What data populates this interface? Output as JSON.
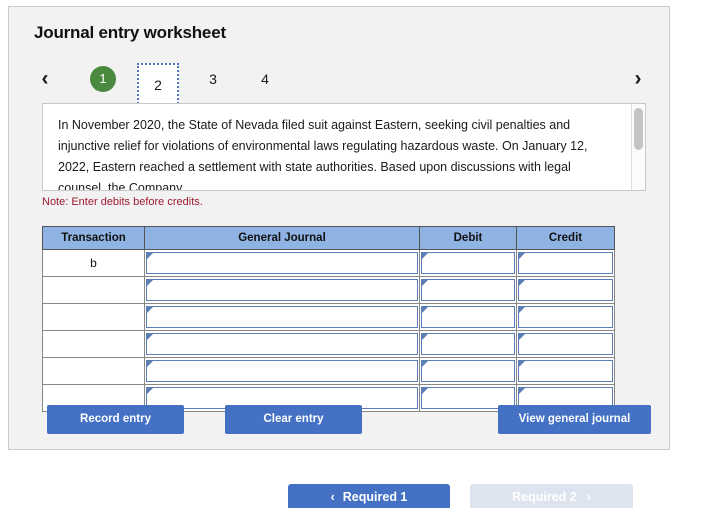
{
  "card": {
    "title": "Journal entry worksheet"
  },
  "tabs": {
    "prev_icon": "chevron-left-icon",
    "next_icon": "chevron-right-icon",
    "items": [
      {
        "label": "1",
        "state": "completed"
      },
      {
        "label": "2",
        "state": "current"
      },
      {
        "label": "3",
        "state": "default"
      },
      {
        "label": "4",
        "state": "default"
      }
    ]
  },
  "narrative": {
    "text": "In November 2020, the State of Nevada filed suit against Eastern, seeking civil penalties and injunctive relief for violations of environmental laws regulating hazardous waste. On January 12, 2022, Eastern reached a settlement with state authorities. Based upon discussions with legal counsel, the Company"
  },
  "note": {
    "text": "Note: Enter debits before credits."
  },
  "table": {
    "headers": [
      "Transaction",
      "General Journal",
      "Debit",
      "Credit"
    ],
    "rows": [
      {
        "transaction": "b",
        "general_journal": "",
        "debit": "",
        "credit": ""
      },
      {
        "transaction": "",
        "general_journal": "",
        "debit": "",
        "credit": ""
      },
      {
        "transaction": "",
        "general_journal": "",
        "debit": "",
        "credit": ""
      },
      {
        "transaction": "",
        "general_journal": "",
        "debit": "",
        "credit": ""
      },
      {
        "transaction": "",
        "general_journal": "",
        "debit": "",
        "credit": ""
      },
      {
        "transaction": "",
        "general_journal": "",
        "debit": "",
        "credit": ""
      }
    ]
  },
  "actions": {
    "record": "Record entry",
    "clear": "Clear entry",
    "view": "View general journal"
  },
  "footer": {
    "required_1": "Required 1",
    "required_2": "Required 2",
    "prev_icon": "chevron-left-icon",
    "next_icon": "chevron-right-icon"
  },
  "colors": {
    "accent_blue": "#4471c4",
    "header_blue": "#8fb4e3",
    "completed_green": "#4a8a3f",
    "note_red": "#9e1b32",
    "disabled_blue": "#dde3ef"
  }
}
